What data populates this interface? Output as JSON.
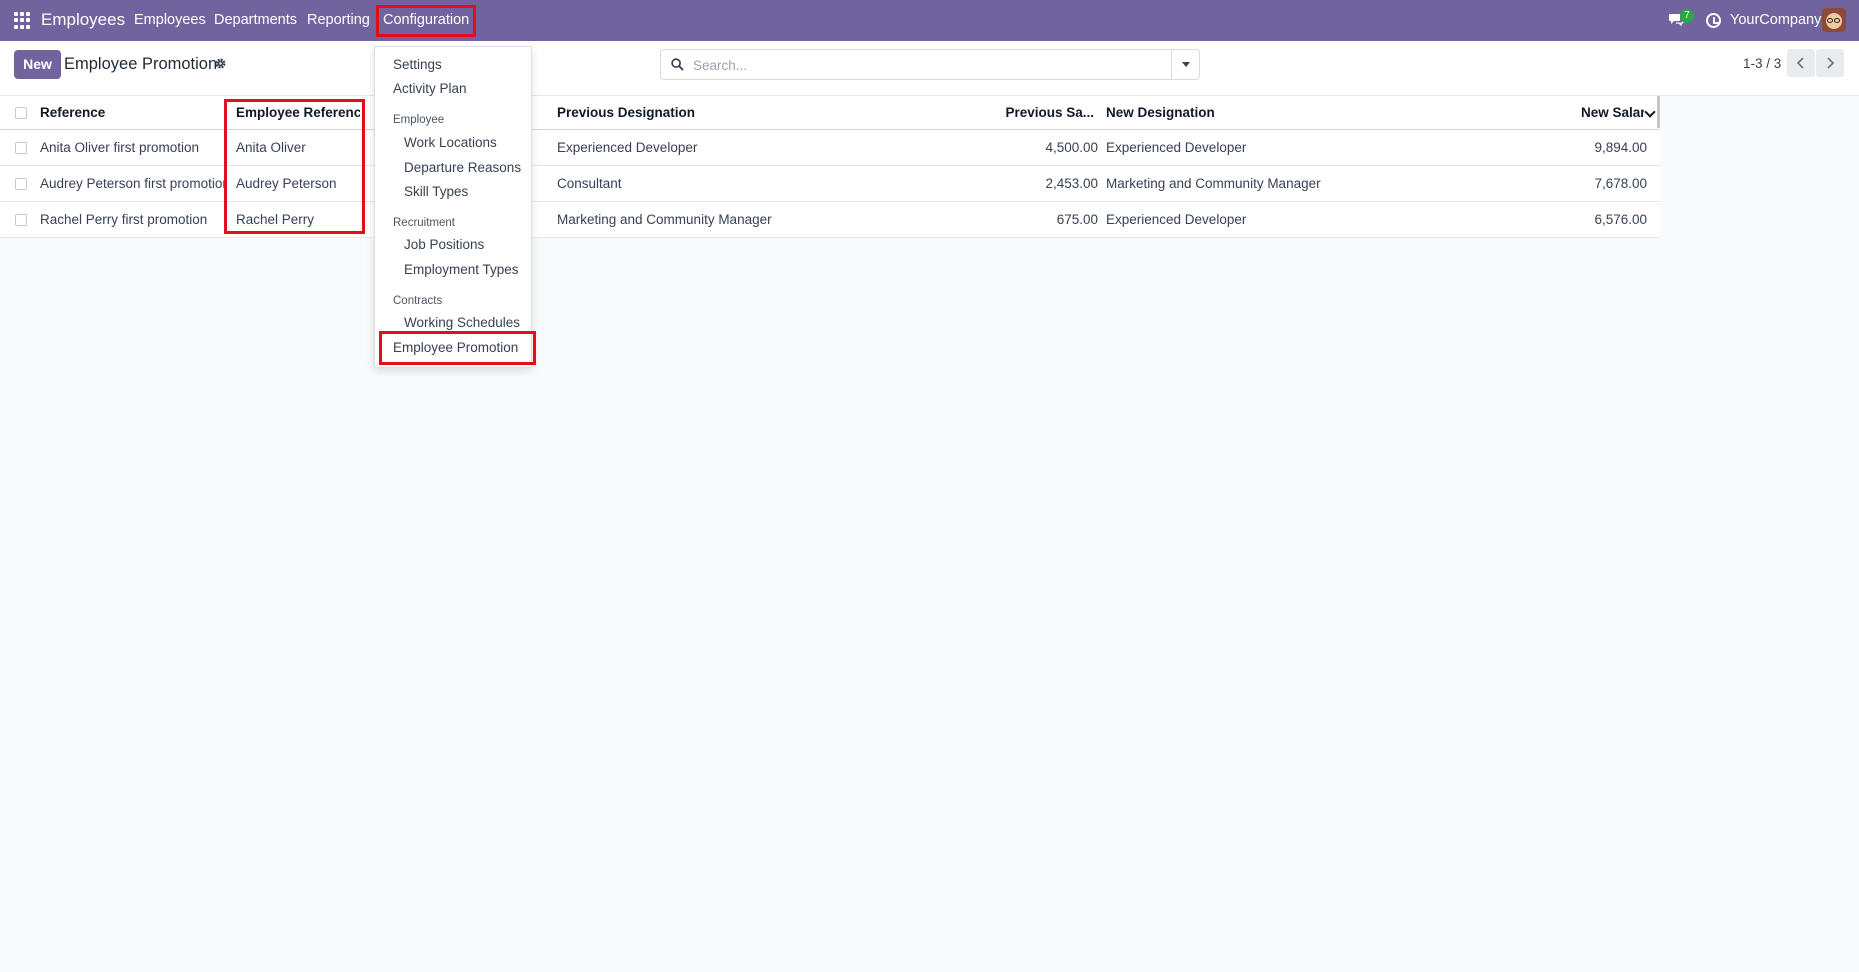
{
  "navbar": {
    "brand": "Employees",
    "menu": [
      "Employees",
      "Departments",
      "Reporting",
      "Configuration"
    ],
    "chat_badge": "7",
    "company": "YourCompany"
  },
  "control": {
    "new_label": "New",
    "title": "Employee Promotion",
    "search_placeholder": "Search...",
    "pager": "1-3 / 3"
  },
  "table": {
    "columns": [
      "Reference",
      "Employee Reference",
      "Previous Designation",
      "Previous Sa...",
      "New Designation",
      "New Salary"
    ],
    "rows": [
      {
        "reference": "Anita Oliver first promotion",
        "employee": "Anita Oliver",
        "prev_designation": "Experienced Developer",
        "prev_salary": "4,500.00",
        "new_designation": "Experienced Developer",
        "new_salary": "9,894.00"
      },
      {
        "reference": "Audrey Peterson first promotion",
        "employee": "Audrey Peterson",
        "prev_designation": "Consultant",
        "prev_salary": "2,453.00",
        "new_designation": "Marketing and Community Manager",
        "new_salary": "7,678.00"
      },
      {
        "reference": "Rachel Perry first promotion",
        "employee": "Rachel Perry",
        "prev_designation": "Marketing and Community Manager",
        "prev_salary": "675.00",
        "new_designation": "Experienced Developer",
        "new_salary": "6,576.00"
      }
    ]
  },
  "config_menu": {
    "settings": "Settings",
    "activity_plan": "Activity Plan",
    "employee_header": "Employee",
    "work_locations": "Work Locations",
    "departure_reasons": "Departure Reasons",
    "skill_types": "Skill Types",
    "recruitment_header": "Recruitment",
    "job_positions": "Job Positions",
    "employment_types": "Employment Types",
    "contracts_header": "Contracts",
    "working_schedules": "Working Schedules",
    "employee_promotion": "Employee Promotion"
  },
  "colors": {
    "navbar": "#71639e",
    "highlight": "#e30d1b",
    "badge": "#28a745"
  }
}
